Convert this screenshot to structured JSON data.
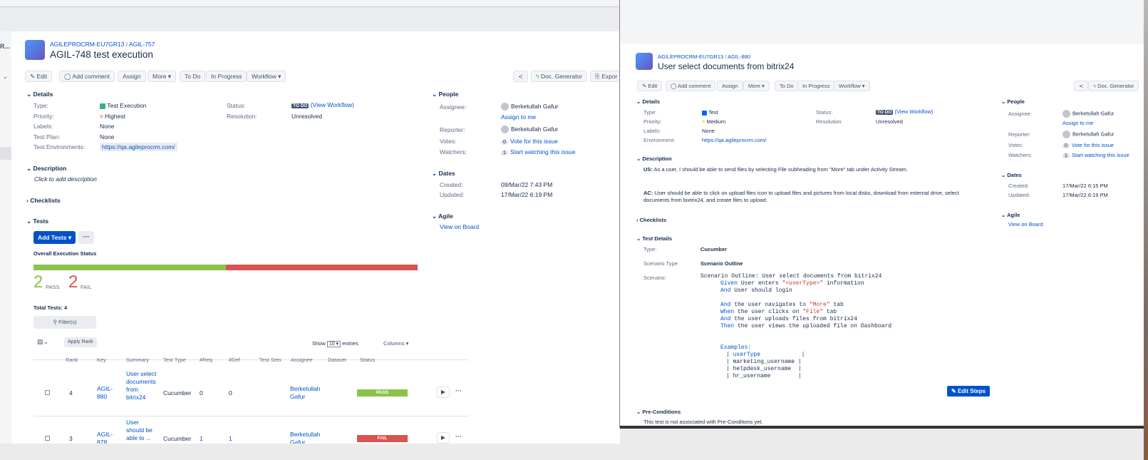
{
  "left": {
    "sidebar_text": "R...",
    "breadcrumb": {
      "project": "AGILEPROCRM-EU7GR13",
      "parent": "AGIL-757"
    },
    "title": "AGIL-748 test execution",
    "toolbar": {
      "edit": "Edit",
      "add_comment": "Add comment",
      "assign": "Assign",
      "more": "More",
      "todo": "To Do",
      "in_progress": "In Progress",
      "workflow": "Workflow",
      "doc_gen": "Doc. Generator",
      "export": "Expor"
    },
    "details": {
      "heading": "Details",
      "type_label": "Type:",
      "type_value": "Test Execution",
      "priority_label": "Priority:",
      "priority_value": "Highest",
      "labels_label": "Labels:",
      "labels_value": "None",
      "testplan_label": "Test Plan:",
      "testplan_value": "None",
      "testenv_label": "Test Environments:",
      "testenv_value": "https://qa.agileprocrm.com/",
      "status_label": "Status:",
      "status_badge": "TO DO",
      "status_link": "(View Workflow)",
      "resolution_label": "Resolution:",
      "resolution_value": "Unresolved"
    },
    "description": {
      "heading": "Description",
      "placeholder": "Click to add description"
    },
    "checklists": {
      "heading": "Checklists"
    },
    "tests": {
      "heading": "Tests",
      "add_tests": "Add Tests",
      "more": "···",
      "overall": "Overall Execution Status",
      "pass_count": "2",
      "pass_label": "PASS",
      "fail_count": "2",
      "fail_label": "FAIL",
      "pass_fraction": 0.5,
      "total": "Total Tests: 4",
      "filter": "Filter(s)",
      "apply_rank": "Apply Rank",
      "show": "Show",
      "entries_value": "10",
      "entries": "entries",
      "columns": "Columns",
      "headers": [
        "Rank",
        "Key",
        "Summary",
        "Test Type",
        "#Req",
        "#Def",
        "Test Sets",
        "Assignee",
        "Dataset",
        "Status"
      ],
      "rows": [
        {
          "rank": "4",
          "key": "AGIL-880",
          "summary": "User select documents from bitrix24",
          "type": "Cucumber",
          "req": "0",
          "def": "0",
          "assignee": "Berketullah Gafur",
          "status": "PASS"
        },
        {
          "rank": "3",
          "key": "AGIL-878",
          "summary": "User should be able to ...",
          "type": "Cucumber",
          "req": "1",
          "def": "1",
          "assignee": "Berketullah Gafur",
          "status": "FAIL"
        }
      ]
    },
    "people": {
      "heading": "People",
      "assignee_label": "Assignee:",
      "assignee_value": "Berketullah Gafur",
      "assign_me": "Assign to me",
      "reporter_label": "Reporter:",
      "reporter_value": "Berketullah Gafur",
      "votes_label": "Votes:",
      "votes_count": "0",
      "votes_link": "Vote for this issue",
      "watchers_label": "Watchers:",
      "watchers_count": "1",
      "watchers_link": "Start watching this issue"
    },
    "dates": {
      "heading": "Dates",
      "created_label": "Created:",
      "created_value": "09/Mar/22 7:43 PM",
      "updated_label": "Updated:",
      "updated_value": "17/Mar/22 6:19 PM"
    },
    "agile": {
      "heading": "Agile",
      "link": "View on Board"
    }
  },
  "right": {
    "breadcrumb": {
      "project": "AGILEPROCRM-EU7GR13",
      "key": "AGIL-880"
    },
    "title": "User select documents from bitrix24",
    "toolbar": {
      "edit": "Edit",
      "add_comment": "Add comment",
      "assign": "Assign",
      "more": "More",
      "todo": "To Do",
      "in_progress": "In Progress",
      "workflow": "Workflow",
      "doc_gen": "Doc. Generator"
    },
    "details": {
      "heading": "Details",
      "type_label": "Type:",
      "type_value": "Test",
      "priority_label": "Priority:",
      "priority_value": "Medium",
      "labels_label": "Labels:",
      "labels_value": "None",
      "env_label": "Environment:",
      "env_value": "https://qa.agileprocrm.com/",
      "status_label": "Status:",
      "status_badge": "TO DO",
      "status_link": "(View Workflow)",
      "resolution_label": "Resolution:",
      "resolution_value": "Unresolved"
    },
    "description": {
      "heading": "Description",
      "us_label": "US:",
      "us_text": "As a user, I should be able to send files by selecting File subheading from \"More\" tab under Activity Stream.",
      "ac_label": "AC:",
      "ac_line1": "User should be able to click on upload files icon to upload files and pictures from local disks, download from external drive, select",
      "ac_line2": "documents from bixtrix24, and create files to upload."
    },
    "checklists": {
      "heading": "Checklists"
    },
    "test_details": {
      "heading": "Test Details",
      "type_label": "Type:",
      "type_value": "Cucumber",
      "scenario_type_label": "Scenario Type:",
      "scenario_type_value": "Scenario Outline",
      "scenario_label": "Scenario:",
      "scenario_title": "Scenario Outline: User select documents from bitrix24",
      "lines": [
        {
          "kw": "Given",
          "pre": " User enters ",
          "str": "\"<userType>\"",
          "post": " information"
        },
        {
          "kw": "And",
          "pre": " User should login",
          "str": "",
          "post": ""
        },
        {
          "kw": "",
          "pre": "",
          "str": "",
          "post": ""
        },
        {
          "kw": "And",
          "pre": " the user navigates to ",
          "str": "\"More\"",
          "post": " tab"
        },
        {
          "kw": "When",
          "pre": " the user clicks on ",
          "str": "\"File\"",
          "post": " tab"
        },
        {
          "kw": "And",
          "pre": " the user uploads files from bitrix24",
          "str": "",
          "post": ""
        },
        {
          "kw": "Then",
          "pre": " the user views the uploaded file on Dashboard",
          "str": "",
          "post": ""
        }
      ],
      "examples_label": "Examples:",
      "examples_header": "userType",
      "examples_rows": [
        "marketing_username",
        "helpdesk_username",
        "hr_username"
      ],
      "edit_steps": "Edit Steps"
    },
    "preconditions": {
      "heading": "Pre-Conditions",
      "text": "This test is not associated with Pre-Conditions yet."
    },
    "people": {
      "heading": "People",
      "assignee_label": "Assignee:",
      "assignee_value": "Berketullah Gafur",
      "assign_me": "Assign to me",
      "reporter_label": "Reporter:",
      "reporter_value": "Berketullah Gafur",
      "votes_label": "Votes:",
      "votes_count": "0",
      "votes_link": "Vote for this issue",
      "watchers_label": "Watchers:",
      "watchers_count": "1",
      "watchers_link": "Start watching this issue"
    },
    "dates": {
      "heading": "Dates",
      "created_label": "Created:",
      "created_value": "17/Mar/22 6:15 PM",
      "updated_label": "Updated:",
      "updated_value": "17/Mar/22 6:19 PM"
    },
    "agile": {
      "heading": "Agile",
      "link": "View on Board"
    }
  },
  "colors": {
    "pass": "#8bc34a",
    "fail": "#d9534f",
    "accent": "#0052cc"
  }
}
